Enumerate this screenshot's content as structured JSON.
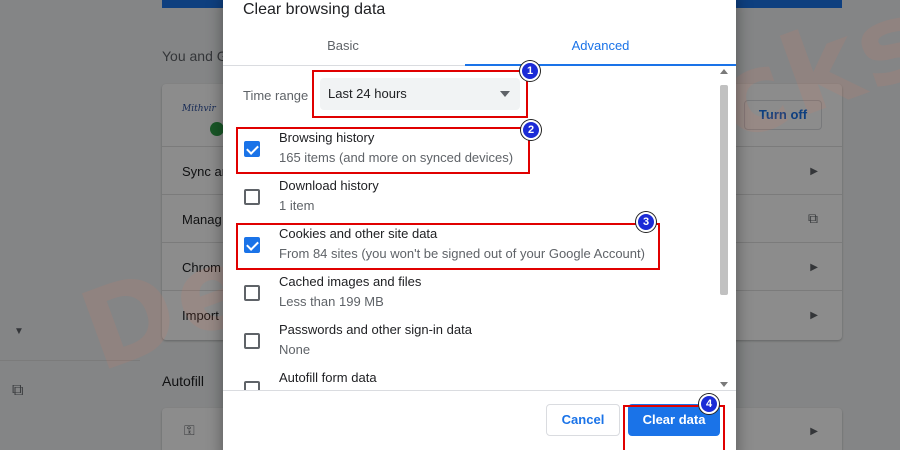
{
  "background": {
    "section_heading": "You and G",
    "profile_logo_text": "Mithvir",
    "turn_off_label": "Turn off",
    "rows": [
      "Sync ar",
      "Manag",
      "Chrom",
      "Import"
    ],
    "autofill_heading": "Autofill"
  },
  "watermark": "DevicesTricks",
  "dialog": {
    "title": "Clear browsing data",
    "tabs": [
      {
        "label": "Basic",
        "active": false
      },
      {
        "label": "Advanced",
        "active": true
      }
    ],
    "time_range": {
      "label": "Time range",
      "value": "Last 24 hours"
    },
    "items": [
      {
        "title": "Browsing history",
        "subtitle": "165 items (and more on synced devices)",
        "checked": true
      },
      {
        "title": "Download history",
        "subtitle": "1 item",
        "checked": false
      },
      {
        "title": "Cookies and other site data",
        "subtitle": "From 84 sites (you won't be signed out of your Google Account)",
        "checked": true
      },
      {
        "title": "Cached images and files",
        "subtitle": "Less than 199 MB",
        "checked": false
      },
      {
        "title": "Passwords and other sign-in data",
        "subtitle": "None",
        "checked": false
      },
      {
        "title": "Autofill form data",
        "subtitle": "",
        "checked": false
      }
    ],
    "cancel_label": "Cancel",
    "clear_label": "Clear data"
  },
  "annotations": {
    "steps": [
      "1",
      "2",
      "3",
      "4"
    ],
    "highlight_color": "#e00000",
    "badge_color": "#1b2bd6"
  },
  "colors": {
    "accent": "#1a73e8"
  }
}
